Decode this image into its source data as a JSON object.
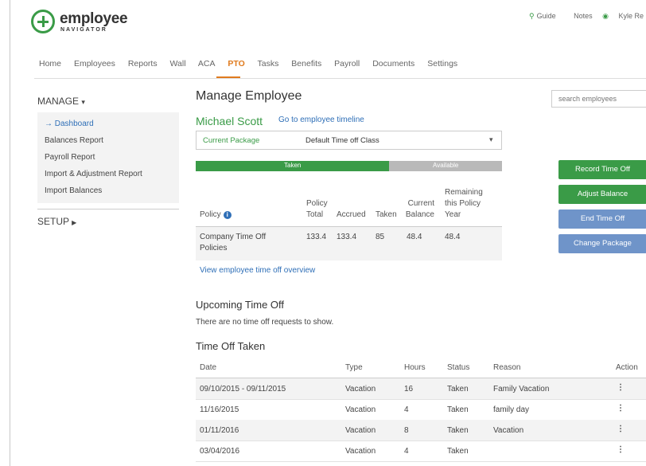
{
  "header": {
    "brand": "employee",
    "brand_sub": "NAVIGATOR",
    "links": [
      "Guide",
      "Notes"
    ],
    "user": "Kyle Re"
  },
  "nav": {
    "items": [
      "Home",
      "Employees",
      "Reports",
      "Wall",
      "ACA",
      "PTO",
      "Tasks",
      "Benefits",
      "Payroll",
      "Documents",
      "Settings"
    ],
    "active": "PTO"
  },
  "sidebar": {
    "manage_label": "MANAGE",
    "items": [
      "→ Dashboard",
      "Balances Report",
      "Payroll Report",
      "Import & Adjustment Report",
      "Import Balances"
    ],
    "setup_label": "SETUP"
  },
  "main": {
    "title": "Manage Employee",
    "search_placeholder": "search employees",
    "employee_name": "Michael Scott",
    "timeline_link": "Go to employee timeline",
    "package_label": "Current Package",
    "package_value": "Default Time off Class",
    "bar": {
      "taken_label": "Taken",
      "available_label": "Available",
      "taken_fraction": 0.632
    },
    "buttons": [
      "Record Time Off",
      "Adjust Balance",
      "End Time Off",
      "Change Package"
    ],
    "policy_table": {
      "headers": [
        "Policy",
        "Policy Total",
        "Accrued",
        "Taken",
        "Current Balance",
        "Remaining this Policy Year"
      ],
      "rows": [
        [
          "Company Time Off Policies",
          "133.4",
          "133.4",
          "85",
          "48.4",
          "48.4"
        ]
      ]
    },
    "overview_link": "View employee time off overview",
    "upcoming_title": "Upcoming Time Off",
    "upcoming_empty": "There are no time off requests to show.",
    "taken_title": "Time Off Taken",
    "taken_table": {
      "headers": [
        "Date",
        "Type",
        "Hours",
        "Status",
        "Reason",
        "Action"
      ],
      "rows": [
        [
          "09/10/2015 - 09/11/2015",
          "Vacation",
          "16",
          "Taken",
          "Family Vacation"
        ],
        [
          "11/16/2015",
          "Vacation",
          "4",
          "Taken",
          "family day"
        ],
        [
          "01/11/2016",
          "Vacation",
          "8",
          "Taken",
          "Vacation"
        ],
        [
          "03/04/2016",
          "Vacation",
          "4",
          "Taken",
          ""
        ]
      ]
    }
  },
  "colors": {
    "brand_green": "#3a9b47",
    "accent_orange": "#e07b1e",
    "link_blue": "#2f6fb7",
    "button_blue": "#6f94c9"
  }
}
